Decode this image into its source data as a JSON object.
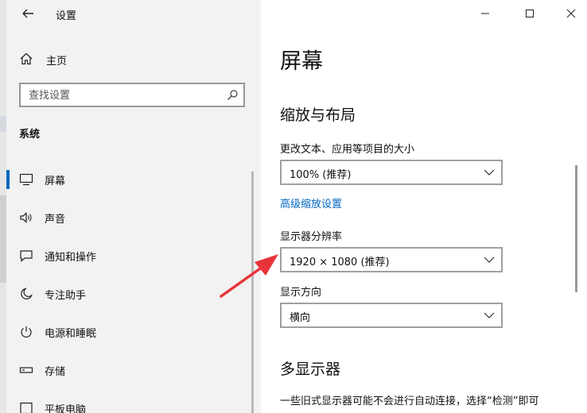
{
  "app": {
    "title": "设置"
  },
  "sidebar": {
    "home_label": "主页",
    "search_placeholder": "查找设置",
    "section": "系统",
    "items": [
      {
        "label": "屏幕",
        "icon": "monitor-icon",
        "active": true
      },
      {
        "label": "声音",
        "icon": "speaker-icon"
      },
      {
        "label": "通知和操作",
        "icon": "notification-icon"
      },
      {
        "label": "专注助手",
        "icon": "moon-icon"
      },
      {
        "label": "电源和睡眠",
        "icon": "power-icon"
      },
      {
        "label": "存储",
        "icon": "storage-icon"
      },
      {
        "label": "平板电脑",
        "icon": "tablet-icon"
      }
    ]
  },
  "main": {
    "title": "屏幕",
    "scale_section": "缩放与布局",
    "scale_label": "更改文本、应用等项目的大小",
    "scale_value": "100% (推荐)",
    "advanced_link": "高级缩放设置",
    "resolution_label": "显示器分辨率",
    "resolution_value": "1920 × 1080 (推荐)",
    "orientation_label": "显示方向",
    "orientation_value": "横向",
    "multi_section": "多显示器",
    "multi_desc": "一些旧式显示器可能不会进行自动连接，选择“检测”即可"
  },
  "colors": {
    "accent": "#0067c0",
    "annotation": "#e8333a"
  }
}
